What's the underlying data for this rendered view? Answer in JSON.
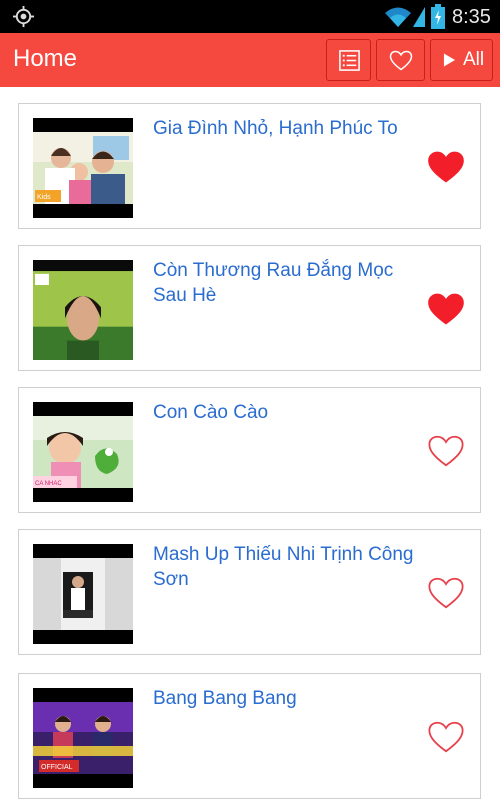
{
  "status_bar": {
    "time": "8:35",
    "icons": [
      "gps-icon",
      "wifi-icon",
      "signal-icon",
      "battery-icon"
    ]
  },
  "action_bar": {
    "title": "Home",
    "buttons": {
      "list_icon": "list-icon",
      "favorite_icon": "heart-outline-icon",
      "play_all_label": "All"
    },
    "colors": {
      "background": "#f5483f",
      "border": "#c8201a"
    }
  },
  "songs": [
    {
      "title": "Gia Đình Nhỏ, Hạnh Phúc To",
      "favorited": true
    },
    {
      "title": "Còn Thương Rau Đắng Mọc Sau Hè",
      "favorited": true
    },
    {
      "title": "Con Cào Cào",
      "favorited": false
    },
    {
      "title": "Mash Up Thiếu Nhi Trịnh Công Sơn",
      "favorited": false
    },
    {
      "title": "Bang Bang Bang",
      "favorited": false
    }
  ],
  "colors": {
    "title_text": "#2a6ccf",
    "heart_filled": "#f21e2a",
    "heart_outline": "#e8404a"
  }
}
